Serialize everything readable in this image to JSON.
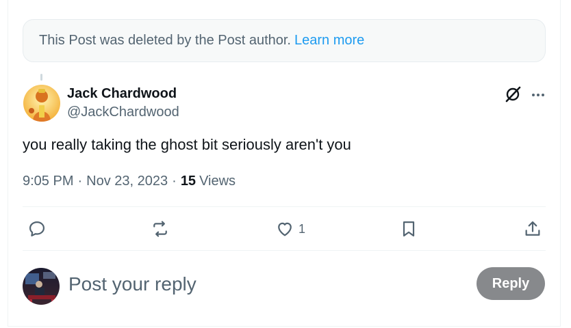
{
  "deleted_notice": {
    "text": "This Post was deleted by the Post author.",
    "link": "Learn more"
  },
  "post": {
    "author_name": "Jack Chardwood",
    "author_handle": "@JackChardwood",
    "text": "you really taking the ghost bit seriously aren't you",
    "time": "9:05 PM",
    "date": "Nov 23, 2023",
    "views_count": "15",
    "views_label": "Views"
  },
  "actions": {
    "reply_icon": "reply-icon",
    "repost_icon": "repost-icon",
    "like_icon": "like-icon",
    "like_count": "1",
    "bookmark_icon": "bookmark-icon",
    "share_icon": "share-icon"
  },
  "composer": {
    "placeholder": "Post your reply",
    "button_label": "Reply"
  },
  "colors": {
    "link": "#1d9bf0",
    "secondary_text": "#536471",
    "reply_button_bg": "#87898c"
  }
}
